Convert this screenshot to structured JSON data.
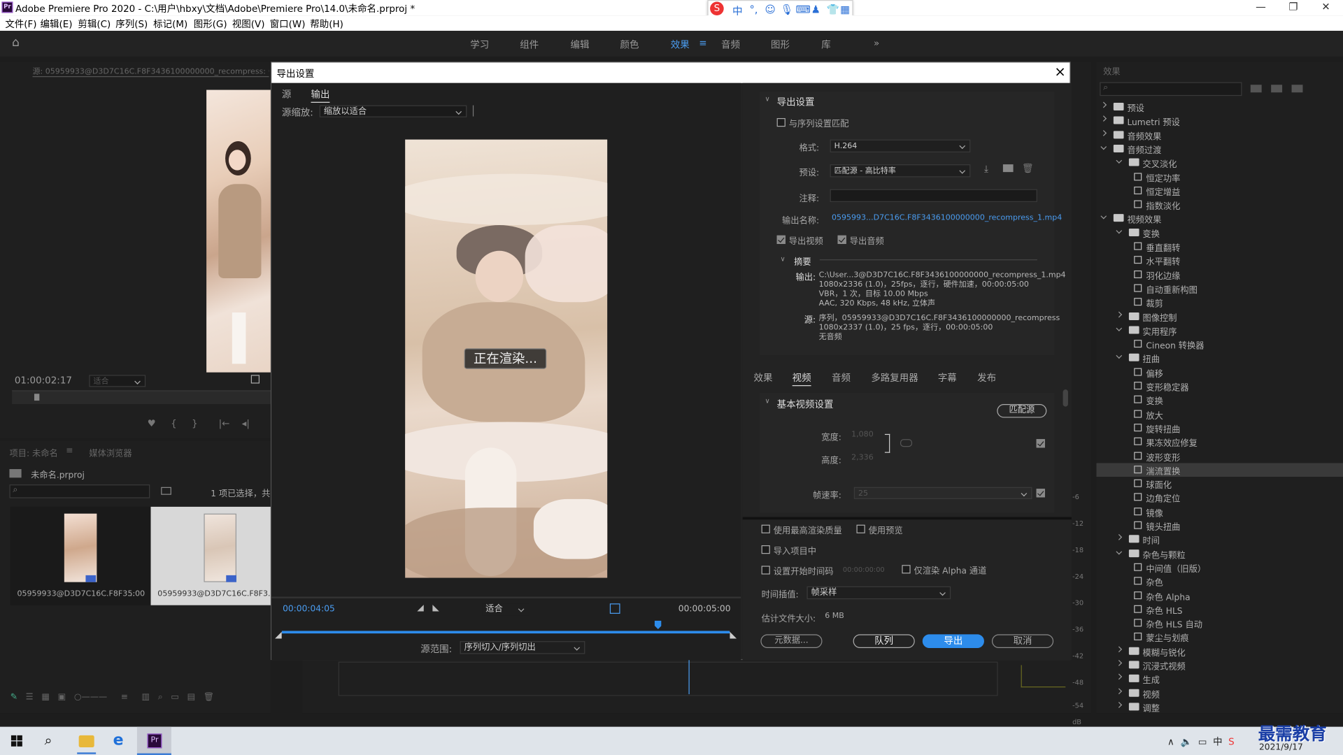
{
  "app": {
    "title": "Adobe Premiere Pro 2020 - C:\\用户\\hbxy\\文档\\Adobe\\Premiere Pro\\14.0\\未命名.prproj *",
    "logo_text": "Pr"
  },
  "menu": [
    "文件(F)",
    "编辑(E)",
    "剪辑(C)",
    "序列(S)",
    "标记(M)",
    "图形(G)",
    "视图(V)",
    "窗口(W)",
    "帮助(H)"
  ],
  "ime": {
    "mode": "中"
  },
  "workspaces": [
    "学习",
    "组件",
    "编辑",
    "颜色",
    "效果",
    "音频",
    "图形",
    "库"
  ],
  "active_workspace": "效果",
  "source_monitor": {
    "tab": "源: 05959933@D3D7C16C.F8F3436100000000_recompress: 05959",
    "timecode": "01:00:02:17",
    "fit": "适合"
  },
  "project": {
    "tab_project": "项目: 未命名",
    "tab_media": "媒体浏览器",
    "file": "未命名.prproj",
    "selection": "1 项已选择，共",
    "items": [
      {
        "name": "05959933@D3D7C16C.F8F3...",
        "duration": "5:00"
      },
      {
        "name": "05959933@D3D7C16C.F8F3...",
        "duration": ""
      }
    ]
  },
  "dialog": {
    "title": "导出设置",
    "close": "×",
    "left_tabs": [
      "源",
      "输出"
    ],
    "scale_label": "源缩放:",
    "scale_value": "缩放以适合",
    "rendering": "正在渲染...",
    "timecode_start": "00:00:04:05",
    "timecode_end": "00:00:05:00",
    "fit_value": "适合",
    "range_label": "源范围:",
    "range_value": "序列切入/序列切出",
    "playhead_fraction": 0.84,
    "export_settings": {
      "section": "导出设置",
      "match_sequence": "与序列设置匹配",
      "format_label": "格式:",
      "format_value": "H.264",
      "preset_label": "预设:",
      "preset_value": "匹配源 - 高比特率",
      "comment_label": "注释:",
      "comment_value": "",
      "output_name_label": "输出名称:",
      "output_name_value": "0595993...D7C16C.F8F3436100000000_recompress_1.mp4",
      "export_video": "导出视频",
      "export_audio": "导出音频",
      "summary_label": "摘要",
      "output_label": "输出:",
      "output_lines": [
        "C:\\User...3@D3D7C16C.F8F3436100000000_recompress_1.mp4",
        "1080x2336 (1.0)，25fps，逐行，硬件加速，00:00:05:00",
        "VBR，1 次，目标 10.00 Mbps",
        "AAC, 320 Kbps, 48 kHz, 立体声"
      ],
      "source_label": "源:",
      "source_lines": [
        "序列，05959933@D3D7C16C.F8F3436100000000_recompress",
        "1080x2337 (1.0)，25 fps，逐行，00:00:05:00",
        "无音频"
      ]
    },
    "right_tabs": [
      "效果",
      "视频",
      "音频",
      "多路复用器",
      "字幕",
      "发布"
    ],
    "active_right_tab": "视频",
    "video": {
      "section": "基本视频设置",
      "match_source": "匹配源",
      "width_label": "宽度:",
      "width_value": "1,080",
      "height_label": "高度:",
      "height_value": "2,336",
      "fps_label": "帧速率:",
      "fps_value": "25"
    },
    "options": {
      "max_quality": "使用最高渲染质量",
      "use_preview": "使用预览",
      "import_project": "导入项目中",
      "set_start_tc": "设置开始时间码",
      "start_tc_value": "00:00:00:00",
      "alpha_only": "仅渲染 Alpha 通道",
      "interp_label": "时间插值:",
      "interp_value": "帧采样",
      "filesize_label": "估计文件大小:",
      "filesize_value": "6 MB"
    },
    "buttons": {
      "metadata": "元数据...",
      "queue": "队列",
      "export": "导出",
      "cancel": "取消"
    }
  },
  "effects_panel": {
    "title": "效果",
    "rows": [
      {
        "level": 0,
        "type": "folder",
        "label": "预设",
        "open": false
      },
      {
        "level": 0,
        "type": "folder",
        "label": "Lumetri 预设",
        "open": false
      },
      {
        "level": 0,
        "type": "folder",
        "label": "音频效果",
        "open": false
      },
      {
        "level": 0,
        "type": "folder",
        "label": "音频过渡",
        "open": true
      },
      {
        "level": 1,
        "type": "folder",
        "label": "交叉淡化",
        "open": true
      },
      {
        "level": 2,
        "type": "effect",
        "label": "恒定功率"
      },
      {
        "level": 2,
        "type": "effect",
        "label": "恒定增益"
      },
      {
        "level": 2,
        "type": "effect",
        "label": "指数淡化"
      },
      {
        "level": 0,
        "type": "folder",
        "label": "视频效果",
        "open": true
      },
      {
        "level": 1,
        "type": "folder",
        "label": "变换",
        "open": true
      },
      {
        "level": 2,
        "type": "effect",
        "label": "垂直翻转"
      },
      {
        "level": 2,
        "type": "effect",
        "label": "水平翻转"
      },
      {
        "level": 2,
        "type": "effect",
        "label": "羽化边缘"
      },
      {
        "level": 2,
        "type": "effect",
        "label": "自动重新构图"
      },
      {
        "level": 2,
        "type": "effect",
        "label": "裁剪"
      },
      {
        "level": 1,
        "type": "folder",
        "label": "图像控制",
        "open": false
      },
      {
        "level": 1,
        "type": "folder",
        "label": "实用程序",
        "open": true
      },
      {
        "level": 2,
        "type": "effect",
        "label": "Cineon 转换器"
      },
      {
        "level": 1,
        "type": "folder",
        "label": "扭曲",
        "open": true
      },
      {
        "level": 2,
        "type": "effect",
        "label": "偏移"
      },
      {
        "level": 2,
        "type": "effect",
        "label": "变形稳定器"
      },
      {
        "level": 2,
        "type": "effect",
        "label": "变换"
      },
      {
        "level": 2,
        "type": "effect",
        "label": "放大"
      },
      {
        "level": 2,
        "type": "effect",
        "label": "旋转扭曲"
      },
      {
        "level": 2,
        "type": "effect",
        "label": "果冻效应修复"
      },
      {
        "level": 2,
        "type": "effect",
        "label": "波形变形"
      },
      {
        "level": 2,
        "type": "effect",
        "label": "湍流置换",
        "selected": true
      },
      {
        "level": 2,
        "type": "effect",
        "label": "球面化"
      },
      {
        "level": 2,
        "type": "effect",
        "label": "边角定位"
      },
      {
        "level": 2,
        "type": "effect",
        "label": "镜像"
      },
      {
        "level": 2,
        "type": "effect",
        "label": "镜头扭曲"
      },
      {
        "level": 1,
        "type": "folder",
        "label": "时间",
        "open": false
      },
      {
        "level": 1,
        "type": "folder",
        "label": "杂色与颗粒",
        "open": true
      },
      {
        "level": 2,
        "type": "effect",
        "label": "中间值（旧版）"
      },
      {
        "level": 2,
        "type": "effect",
        "label": "杂色"
      },
      {
        "level": 2,
        "type": "effect",
        "label": "杂色 Alpha"
      },
      {
        "level": 2,
        "type": "effect",
        "label": "杂色 HLS"
      },
      {
        "level": 2,
        "type": "effect",
        "label": "杂色 HLS 自动"
      },
      {
        "level": 2,
        "type": "effect",
        "label": "蒙尘与划痕"
      },
      {
        "level": 1,
        "type": "folder",
        "label": "模糊与锐化",
        "open": false
      },
      {
        "level": 1,
        "type": "folder",
        "label": "沉浸式视频",
        "open": false
      },
      {
        "level": 1,
        "type": "folder",
        "label": "生成",
        "open": false
      },
      {
        "level": 1,
        "type": "folder",
        "label": "视频",
        "open": false
      },
      {
        "level": 1,
        "type": "folder",
        "label": "调整",
        "open": false
      }
    ]
  },
  "audio_meter": [
    "-6",
    "-12",
    "-18",
    "-24",
    "-30",
    "-36",
    "-42",
    "-48",
    "-54",
    "dB"
  ],
  "taskbar": {
    "date": "2021/9/17",
    "watermark": "最需教育"
  }
}
